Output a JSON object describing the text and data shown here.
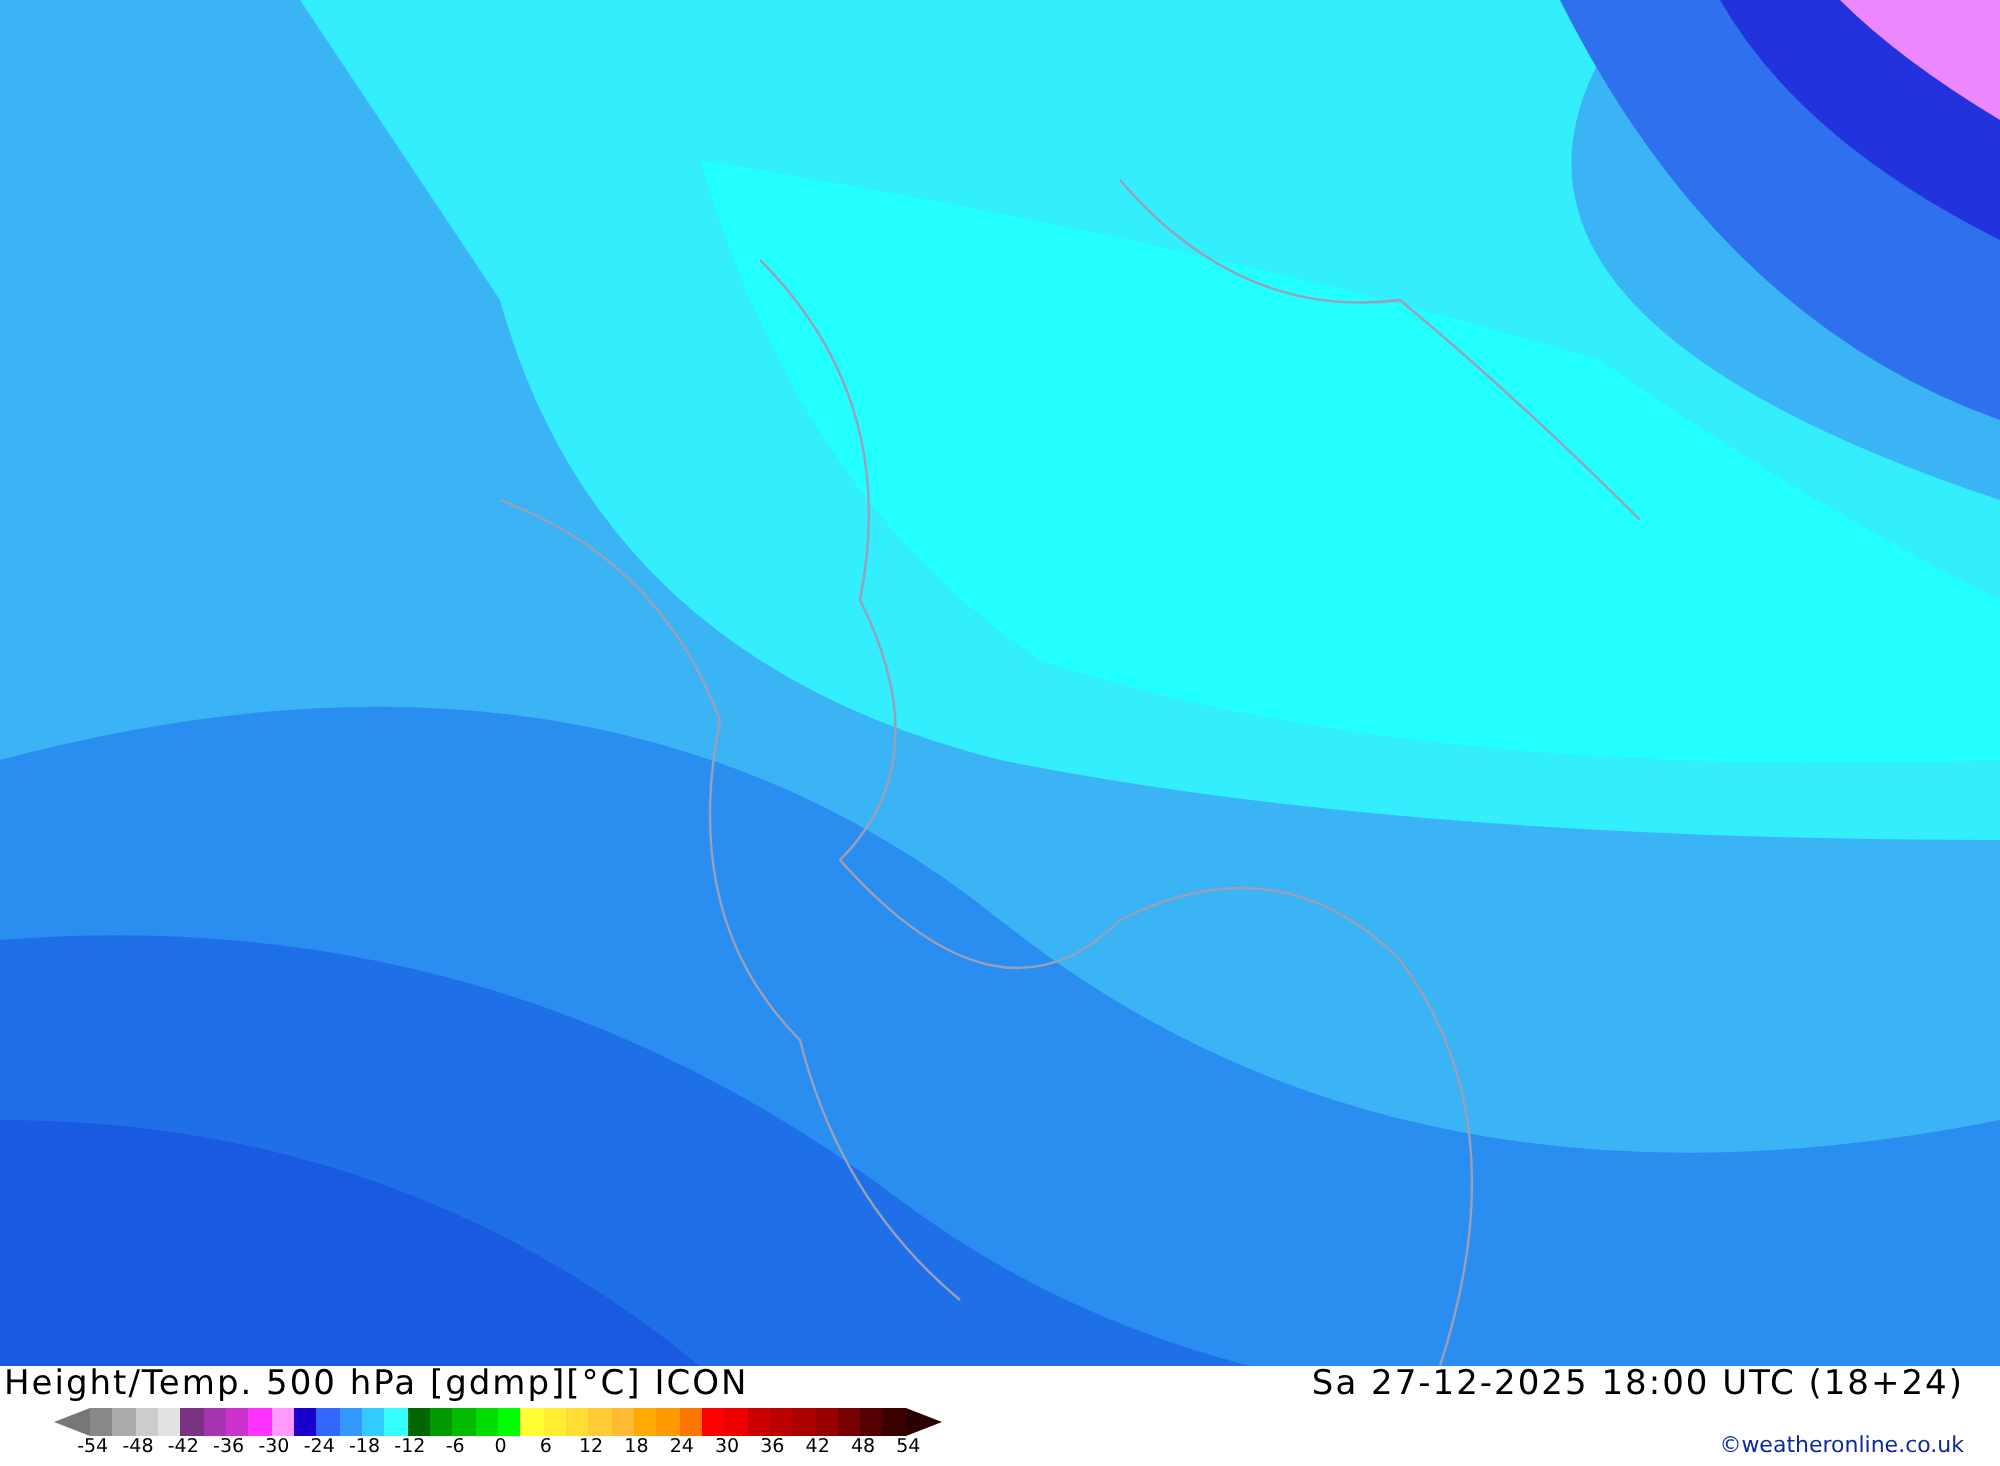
{
  "footer": {
    "title": "Height/Temp. 500 hPa [gdmp][°C] ICON",
    "datetime": "Sa 27-12-2025 18:00 UTC (18+24)",
    "credit": "©weatheronline.co.uk"
  },
  "legend": {
    "segments": [
      {
        "color": "#888888"
      },
      {
        "color": "#aaaaaa"
      },
      {
        "color": "#cccccc"
      },
      {
        "color": "#e2e2e2"
      },
      {
        "color": "#7a3282"
      },
      {
        "color": "#a833b0"
      },
      {
        "color": "#cc33cc"
      },
      {
        "color": "#ff33ff"
      },
      {
        "color": "#ff99ff"
      },
      {
        "color": "#1a00cc"
      },
      {
        "color": "#3366ff"
      },
      {
        "color": "#3399ff"
      },
      {
        "color": "#33ccff"
      },
      {
        "color": "#33ffff"
      },
      {
        "color": "#006600"
      },
      {
        "color": "#009900"
      },
      {
        "color": "#00bb00"
      },
      {
        "color": "#00dd00"
      },
      {
        "color": "#00ff00"
      },
      {
        "color": "#ffff33"
      },
      {
        "color": "#ffee33"
      },
      {
        "color": "#ffdd33"
      },
      {
        "color": "#ffcc33"
      },
      {
        "color": "#ffbb33"
      },
      {
        "color": "#ffaa00"
      },
      {
        "color": "#ff9900"
      },
      {
        "color": "#ff7700"
      },
      {
        "color": "#ff0000"
      },
      {
        "color": "#ee0000"
      },
      {
        "color": "#cc0000"
      },
      {
        "color": "#bb0000"
      },
      {
        "color": "#aa0000"
      },
      {
        "color": "#990000"
      },
      {
        "color": "#770000"
      },
      {
        "color": "#550000"
      },
      {
        "color": "#3a0000"
      }
    ],
    "ticks": [
      "-54",
      "-48",
      "-42",
      "-36",
      "-30",
      "-24",
      "-18",
      "-12",
      "-6",
      "0",
      "6",
      "12",
      "18",
      "24",
      "30",
      "36",
      "42",
      "48",
      "54"
    ]
  }
}
